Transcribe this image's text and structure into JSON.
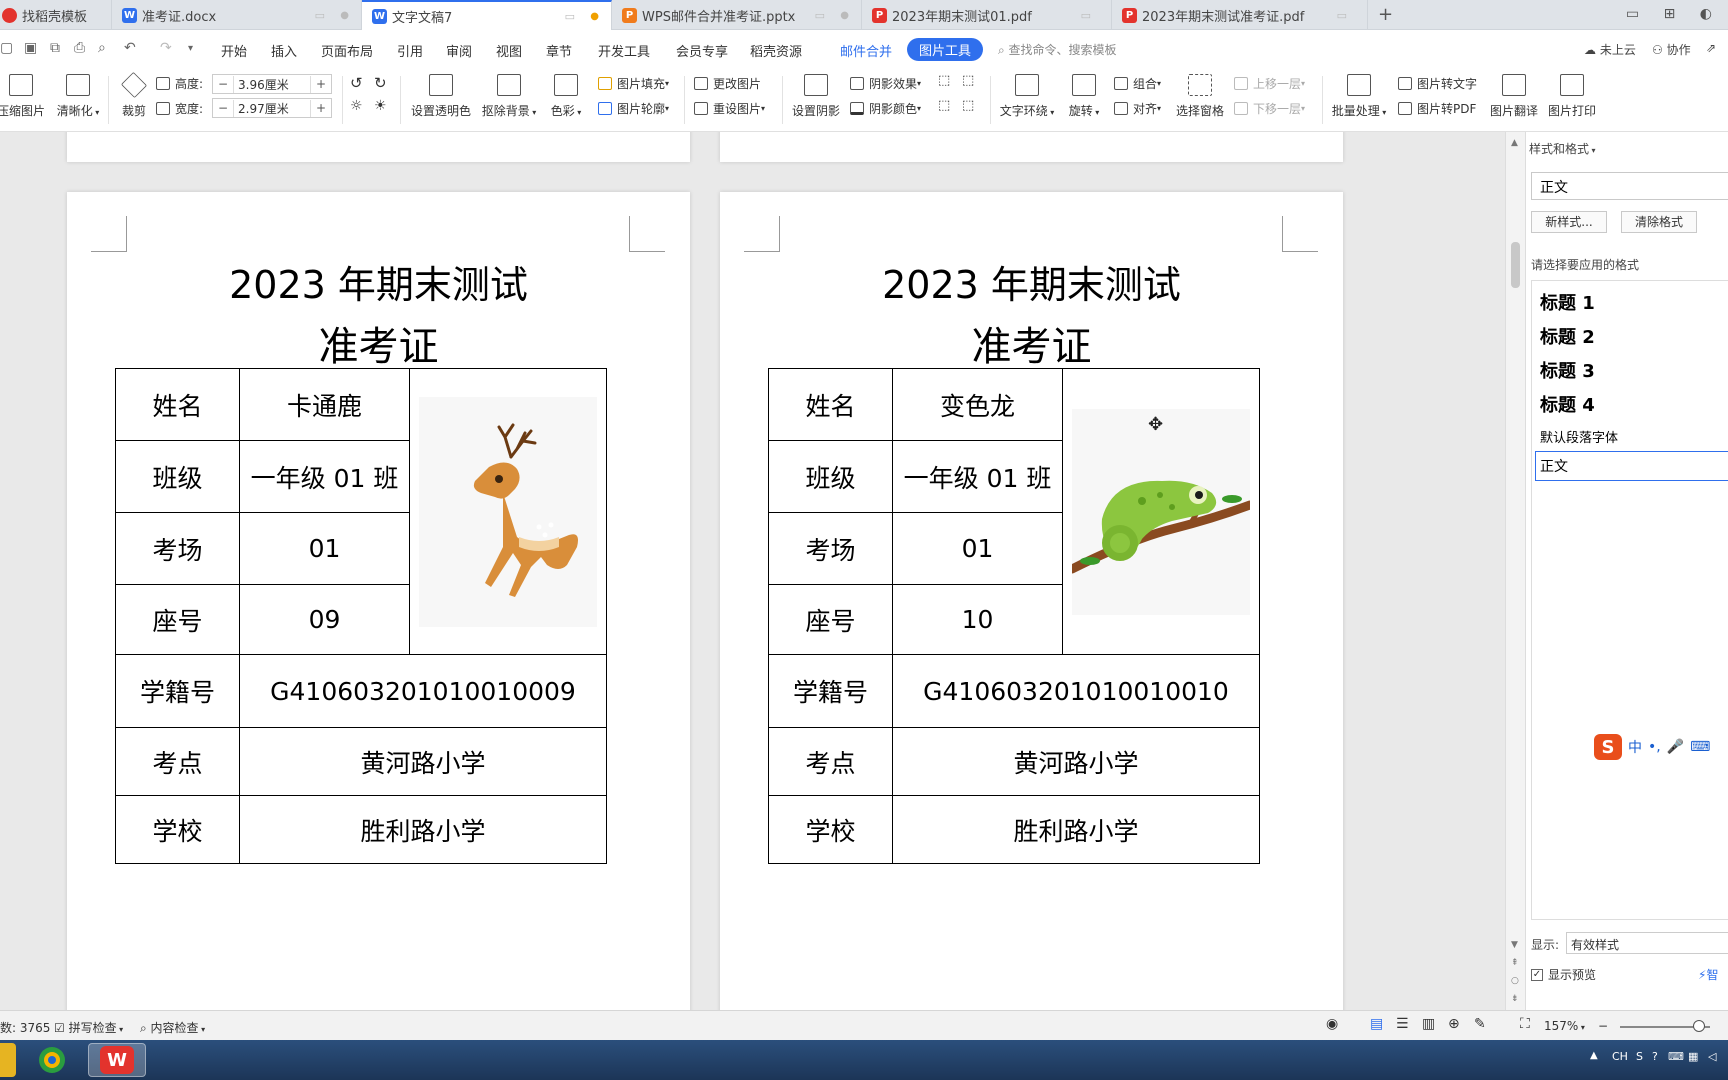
{
  "tabs": [
    {
      "label": "找稻壳模板",
      "icon_color": "#e3332d",
      "icon_char": "",
      "active": false
    },
    {
      "label": "准考证.docx",
      "icon_color": "#2f6fed",
      "icon_char": "W",
      "active": false
    },
    {
      "label": "文字文稿7",
      "icon_color": "#2f6fed",
      "icon_char": "W",
      "active": true
    },
    {
      "label": "WPS邮件合并准考证.pptx",
      "icon_color": "#f07b1c",
      "icon_char": "P",
      "active": false
    },
    {
      "label": "2023年期末测试01.pdf",
      "icon_color": "#e3332d",
      "icon_char": "P",
      "active": false
    },
    {
      "label": "2023年期末测试准考证.pdf",
      "icon_color": "#e3332d",
      "icon_char": "P",
      "active": false
    }
  ],
  "menu": {
    "items": [
      "开始",
      "插入",
      "页面布局",
      "引用",
      "审阅",
      "视图",
      "章节",
      "开发工具",
      "会员专享",
      "稻壳资源"
    ],
    "mail_merge": "邮件合并",
    "picture_tools": "图片工具",
    "search_placeholder": "查找命令、搜索模板",
    "cloud": "未上云",
    "collab": "协作"
  },
  "ribbon": {
    "compress": "压缩图片",
    "sharpen": "清晰化",
    "crop": "裁剪",
    "height_label": "高度:",
    "height_value": "3.96厘米",
    "width_label": "宽度:",
    "width_value": "2.97厘米",
    "set_transparent": "设置透明色",
    "remove_bg": "抠除背景",
    "color": "色彩",
    "pic_fill": "图片填充",
    "pic_outline": "图片轮廓",
    "change_pic": "更改图片",
    "reset_pic": "重设图片",
    "set_shadow": "设置阴影",
    "shadow_effect": "阴影效果",
    "shadow_color": "阴影颜色",
    "text_wrap": "文字环绕",
    "rotate": "旋转",
    "group": "组合",
    "align": "对齐",
    "select_pane": "选择窗格",
    "bring_forward": "上移一层",
    "send_backward": "下移一层",
    "batch": "批量处理",
    "pic_to_text": "图片转文字",
    "pic_to_pdf": "图片转PDF",
    "pic_translate": "图片翻译",
    "pic_print": "图片打印",
    "minus": "−",
    "plus": "+"
  },
  "cards": [
    {
      "title": "2023 年期末测试",
      "subtitle": "准考证",
      "labels": {
        "name": "姓名",
        "class": "班级",
        "room": "考场",
        "seat": "座号",
        "student_id": "学籍号",
        "site": "考点",
        "school": "学校"
      },
      "name": "卡通鹿",
      "class": "一年级 01 班",
      "room": "01",
      "seat": "09",
      "student_id": "G410603201010010009",
      "site": "黄河路小学",
      "school": "胜利路小学",
      "photo_icon": "deer-icon"
    },
    {
      "title": "2023 年期末测试",
      "subtitle": "准考证",
      "labels": {
        "name": "姓名",
        "class": "班级",
        "room": "考场",
        "seat": "座号",
        "student_id": "学籍号",
        "site": "考点",
        "school": "学校"
      },
      "name": "变色龙",
      "class": "一年级 01 班",
      "room": "01",
      "seat": "10",
      "student_id": "G410603201010010010",
      "site": "黄河路小学",
      "school": "胜利路小学",
      "photo_icon": "chameleon-icon"
    }
  ],
  "styles_pane": {
    "title": "样式和格式",
    "current_style": "正文",
    "new_style": "新样式...",
    "clear_format": "清除格式",
    "choose_label": "请选择要应用的格式",
    "items": [
      "标题  1",
      "标题  2",
      "标题  3",
      "标题  4"
    ],
    "default_font": "默认段落字体",
    "selected": "正文",
    "show_label": "显示:",
    "show_value": "有效样式",
    "preview_label": "显示预览",
    "smart": "智"
  },
  "statusbar": {
    "word_count": "数: 3765",
    "spell_check": "拼写检查",
    "content_check": "内容检查",
    "zoom": "157%"
  },
  "ime": {
    "lang": "中"
  },
  "tray": {
    "lang": "CH"
  }
}
